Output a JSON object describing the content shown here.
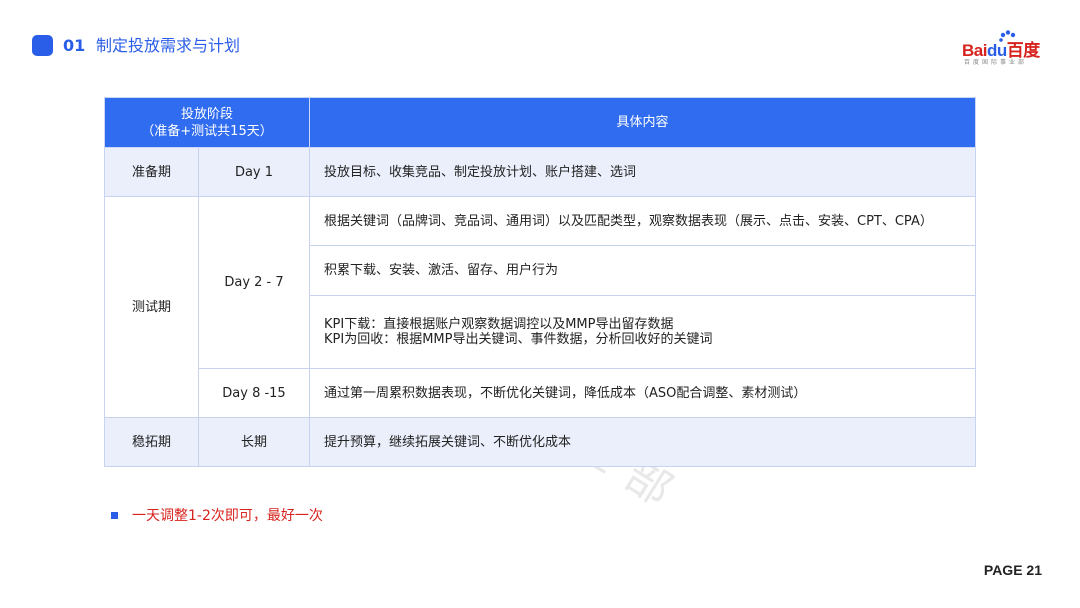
{
  "header": {
    "number": "01",
    "title": "制定投放需求与计划"
  },
  "logo": {
    "text_left": "Bai",
    "text_mid": "du",
    "text_right": "百度",
    "subtitle": "百度国际事业部",
    "colors": {
      "red": "#D7231E",
      "blue": "#2B5EE8"
    }
  },
  "table": {
    "head": {
      "stage_line1": "投放阶段",
      "stage_line2": "（准备+测试共15天）",
      "content": "具体内容"
    },
    "rows": {
      "prep": {
        "stage": "准备期",
        "day": "Day 1",
        "content": "投放目标、收集竞品、制定投放计划、账户搭建、选词"
      },
      "test": {
        "stage": "测试期",
        "day_a": "Day 2 - 7",
        "content_a1": "根据关键词（品牌词、竞品词、通用词）以及匹配类型，观察数据表现（展示、点击、安装、CPT、CPA）",
        "content_a2": "积累下载、安装、激活、留存、用户行为",
        "content_a3_line1": "KPI下载：直接根据账户观察数据调控以及MMP导出留存数据",
        "content_a3_line2": "KPI为回收：根据MMP导出关键词、事件数据，分析回收好的关键词",
        "day_b": "Day 8 -15",
        "content_b": "通过第一周累积数据表现，不断优化关键词，降低成本（ASO配合调整、素材测试）"
      },
      "stable": {
        "stage": "稳拓期",
        "day": "长期",
        "content": "提升预算，继续拓展关键词、不断优化成本"
      }
    },
    "colors": {
      "header_bg": "#2F6CF0",
      "shade_bg": "#EAEFFB",
      "border": "#c7d3ef"
    }
  },
  "note": {
    "text": "一天调整1-2次即可，最好一次"
  },
  "page": {
    "label": "PAGE 21"
  },
  "watermark": {
    "text_latin": "Bai",
    "text_cn": "百度",
    "text_sub": "百度国际事业部"
  }
}
